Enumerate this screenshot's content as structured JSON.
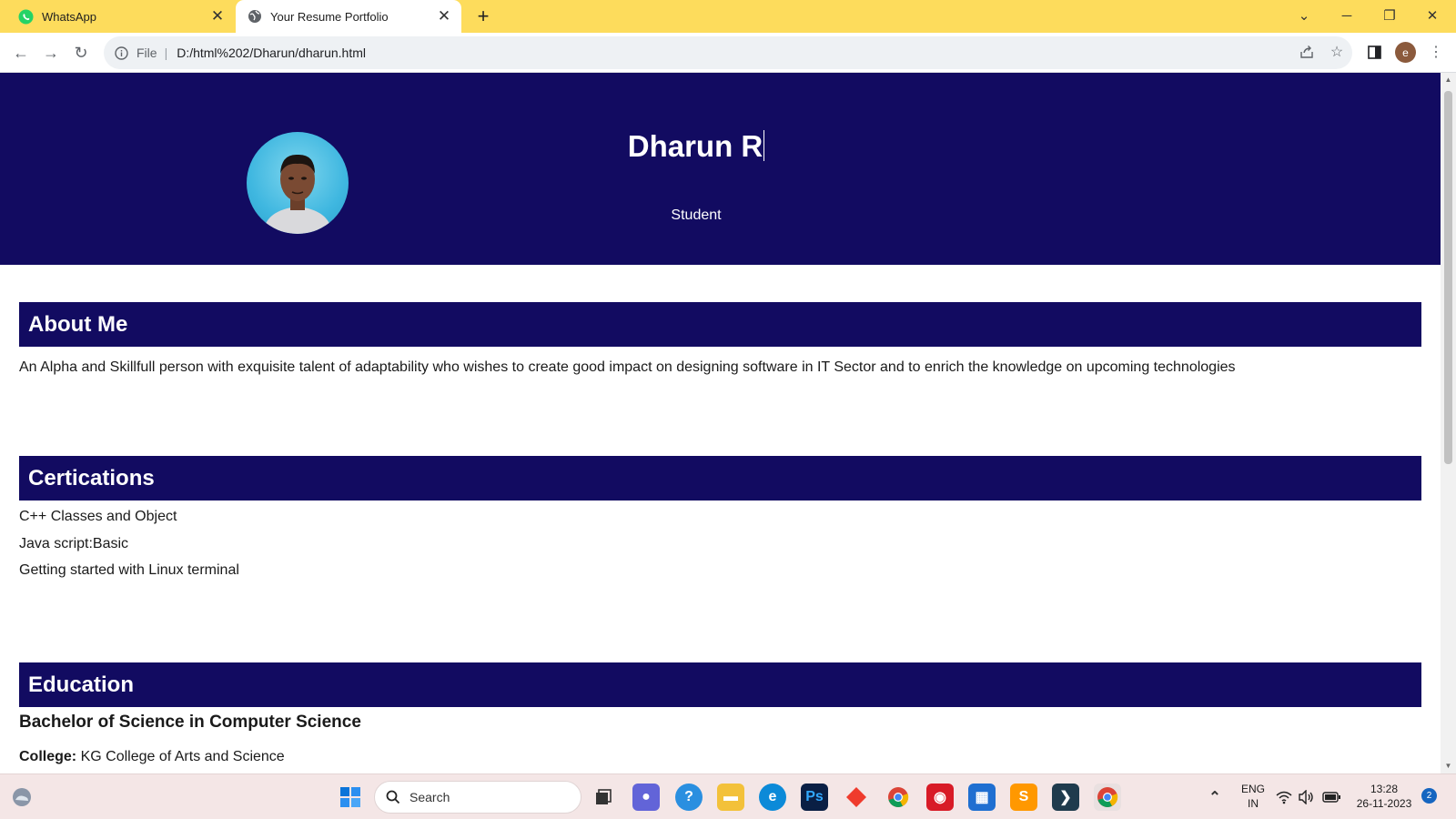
{
  "browser": {
    "tabs": [
      {
        "title": "WhatsApp",
        "active": false,
        "icon": "whatsapp-icon",
        "icon_color": "#25d366"
      },
      {
        "title": "Your Resume Portfolio",
        "active": true,
        "icon": "globe-icon"
      }
    ],
    "address": {
      "scheme": "File",
      "url": "D:/html%202/Dharun/dharun.html"
    },
    "profile_initial": "e",
    "accent": "#fddc5c"
  },
  "page": {
    "header": {
      "name": "Dharun R",
      "role": "Student",
      "bg_color": "#120b61"
    },
    "about": {
      "heading": "About Me",
      "text": "An Alpha and Skillfull person with exquisite talent of adaptability who wishes to create good impact on designing software in IT Sector and to enrich the knowledge on upcoming technologies"
    },
    "certifications": {
      "heading": "Certications",
      "items": [
        "C++ Classes and Object",
        "Java script:Basic",
        "Getting started with Linux terminal"
      ]
    },
    "education": {
      "heading": "Education",
      "degree": "Bachelor of Science in Computer Science",
      "college_label": "College:",
      "college": "KG College of Arts and Science"
    }
  },
  "taskbar": {
    "search_label": "Search",
    "language_line1": "ENG",
    "language_line2": "IN",
    "time": "13:28",
    "date": "26-11-2023",
    "notification_count": "2"
  }
}
